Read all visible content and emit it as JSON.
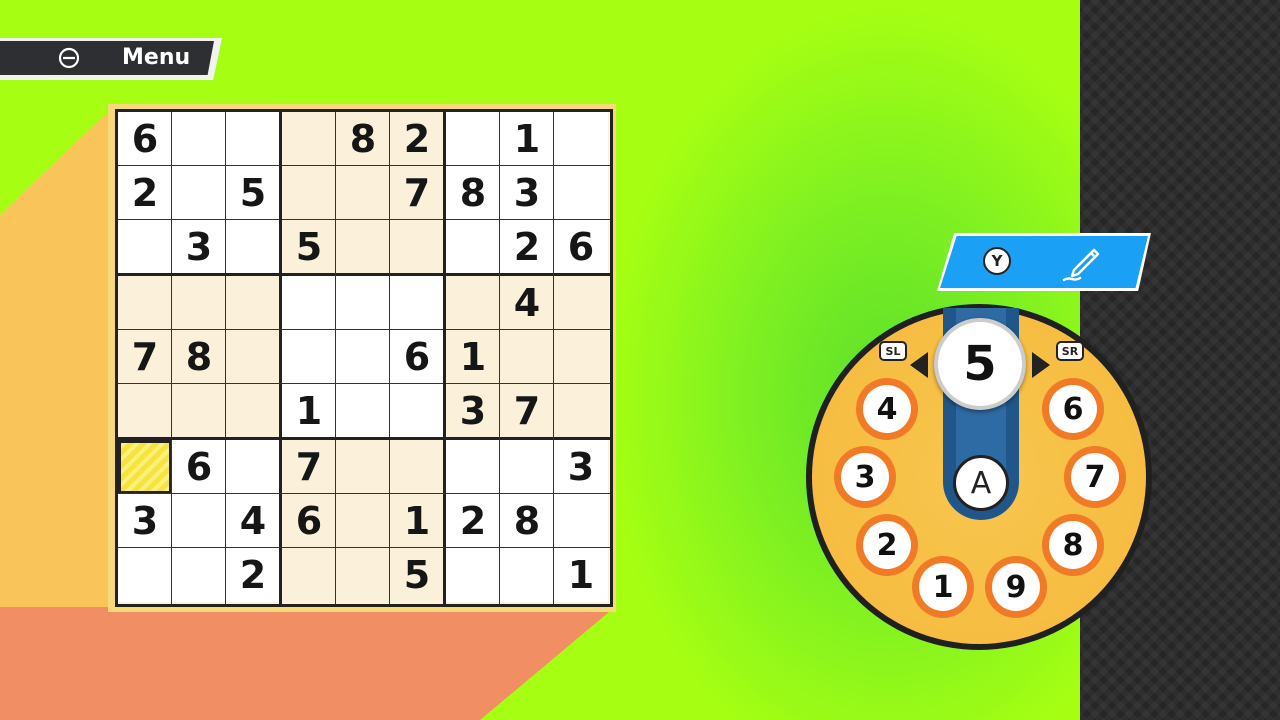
{
  "menu": {
    "label": "Menu",
    "icon": "back-icon"
  },
  "board": {
    "rows": [
      [
        "6",
        "",
        "",
        "",
        "8",
        "2",
        "",
        "1",
        ""
      ],
      [
        "2",
        "",
        "5",
        "",
        "",
        "7",
        "8",
        "3",
        ""
      ],
      [
        "",
        "3",
        "",
        "5",
        "",
        "",
        "",
        "2",
        "6"
      ],
      [
        "",
        "",
        "",
        "",
        "",
        "",
        "",
        "4",
        ""
      ],
      [
        "7",
        "8",
        "",
        "",
        "",
        "6",
        "1",
        "",
        ""
      ],
      [
        "",
        "",
        "",
        "1",
        "",
        "",
        "3",
        "7",
        ""
      ],
      [
        "",
        "6",
        "",
        "7",
        "",
        "",
        "",
        "",
        "3"
      ],
      [
        "3",
        "",
        "4",
        "6",
        "",
        "1",
        "2",
        "8",
        ""
      ],
      [
        "",
        "",
        "2",
        "",
        "",
        "5",
        "",
        "",
        "1"
      ]
    ],
    "selected_cell": {
      "row": 6,
      "col": 0
    }
  },
  "pencil_mode": {
    "button": "Y",
    "icon": "pencil-icon"
  },
  "number_dial": {
    "selected": "5",
    "confirm_button": "A",
    "prev_button": "SL",
    "next_button": "SR",
    "numbers": [
      "1",
      "2",
      "3",
      "4",
      "6",
      "7",
      "8",
      "9"
    ]
  },
  "colors": {
    "background": "#a6ff12",
    "accent_blue": "#1aa0f5",
    "dial_orange": "#f07a26",
    "dial_yellow": "#f5b93c",
    "selected_cell": "#f6e33e"
  }
}
